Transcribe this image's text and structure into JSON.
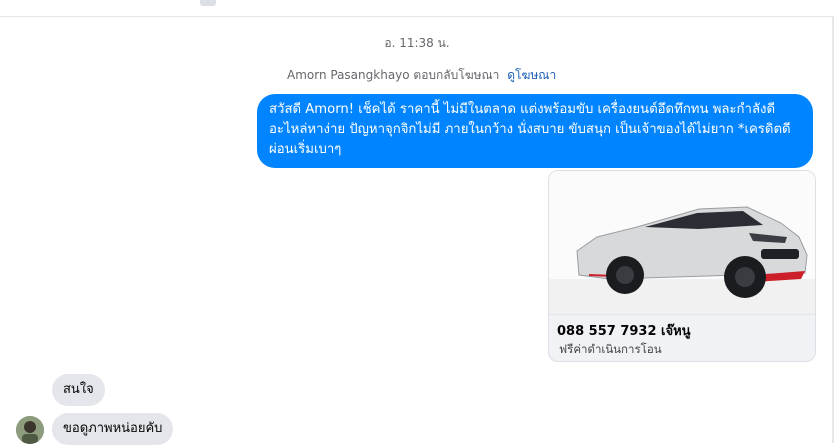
{
  "thread": {
    "timestamp": "อ. 11:38 น.",
    "reply_context": {
      "text": "Amorn Pasangkhayo ตอบกลับโฆษณา",
      "link": "ดูโฆษณา"
    }
  },
  "outgoing_message": {
    "text": "สวัสดี Amorn! เช็คได้ ราคานี้ ไม่มีในตลาด แต่งพร้อมขับ เครื่องยนต์อึดทึกทน พละกำลังดี อะไหล่หาง่าย ปัญหาจุกจิกไม่มี ภายในกว้าง นั่งสบาย ขับสนุก เป็นเจ้าของได้ไม่ยาก *เครดิตดี ผ่อนเริ่มเบาๆ",
    "color": "#0084ff"
  },
  "ad_card": {
    "title": "088 557 7932 เจ๊หนู",
    "subtitle": "ฟรีค่าดำเนินการโอน",
    "image": "white-sedan-car-photo"
  },
  "incoming_messages": [
    {
      "text": "สนใจ"
    },
    {
      "text": "ขอดูภาพหน่อยคับ"
    }
  ]
}
